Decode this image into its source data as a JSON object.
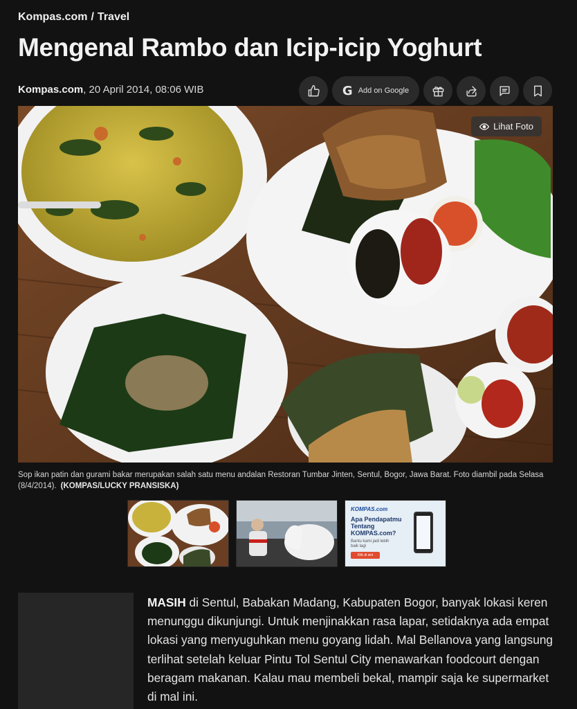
{
  "breadcrumb": {
    "site": "Kompas.com",
    "separator": "/",
    "section": "Travel"
  },
  "title": "Mengenal Rambo dan Icip-icip Yoghurt",
  "meta": {
    "source": "Kompas.com",
    "date": "20 April 2014, 08:06 WIB"
  },
  "actions": {
    "like_icon": "thumbs-up-icon",
    "google_label": "Add on Google",
    "gift_icon": "gift-icon",
    "share_icon": "share-icon",
    "comment_icon": "comment-icon",
    "bookmark_icon": "bookmark-icon"
  },
  "hero": {
    "view_photo_label": "Lihat Foto"
  },
  "caption": {
    "text": "Sop ikan patin dan gurami bakar merupakan salah satu menu andalan Restoran Tumbar Jinten, Sentul, Bogor, Jawa Barat. Foto diambil pada Selasa (8/4/2014).",
    "credit": "(KOMPAS/LUCKY PRANSISKA)"
  },
  "ad": {
    "logo": "KOMPAS.com",
    "title": "Apa Pendapatmu Tentang KOMPAS.com?",
    "subtitle": "Bantu kami jadi lebih baik lagi",
    "button": "Klik di sini"
  },
  "article": {
    "lead_word": "MASIH",
    "paragraph": " di Sentul, Babakan Madang, Kabupaten Bogor, banyak lokasi keren menunggu dikunjungi. Untuk menjinakkan rasa lapar, setidaknya ada empat lokasi yang menyuguhkan menu goyang lidah. Mal Bellanova yang langsung terlihat setelah keluar Pintu Tol Sentul City menawarkan foodcourt dengan beragam makanan. Kalau mau membeli bekal, mampir saja ke supermarket di mal ini."
  }
}
